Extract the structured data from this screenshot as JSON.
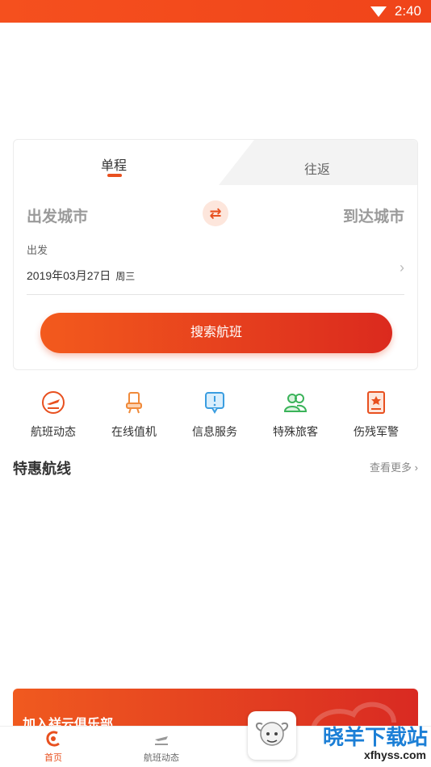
{
  "status_bar": {
    "time": "2:40",
    "wifi_icon": "wifi-icon"
  },
  "search": {
    "tabs": [
      {
        "label": "单程",
        "active": true
      },
      {
        "label": "往返",
        "active": false
      }
    ],
    "from_city": "出发城市",
    "to_city": "到达城市",
    "swap_icon": "swap-arrows-icon",
    "swap_glyph": "⇄",
    "depart_label": "出发",
    "depart_date": "2019年03月27日",
    "depart_weekday": "周三",
    "chevron": "›",
    "search_button": "搜索航班"
  },
  "quick_menu": [
    {
      "label": "航班动态",
      "icon": "airplane-icon"
    },
    {
      "label": "在线值机",
      "icon": "seat-icon"
    },
    {
      "label": "信息服务",
      "icon": "info-bubble-icon"
    },
    {
      "label": "特殊旅客",
      "icon": "passengers-icon"
    },
    {
      "label": "伤残军警",
      "icon": "certificate-icon"
    }
  ],
  "special_routes": {
    "title": "特惠航线",
    "more": "查看更多 ›"
  },
  "club_banner": {
    "text": "加入祥云俱乐部"
  },
  "bottom_nav": [
    {
      "label": "首页",
      "icon": "home-logo-icon",
      "active": true
    },
    {
      "label": "航班动态",
      "icon": "airplane-icon",
      "active": false
    }
  ],
  "watermark": {
    "title": "晓羊下载站",
    "url": "xfhyss.com"
  },
  "colors": {
    "accent": "#e8501f",
    "status_bar": "#f5501e",
    "button_end": "#db2a1e"
  }
}
